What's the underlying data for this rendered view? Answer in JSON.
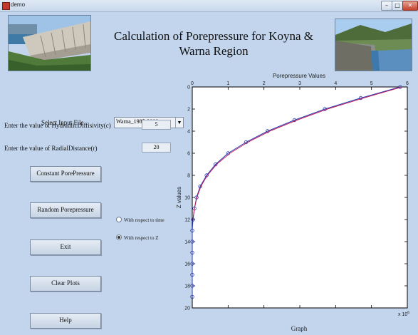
{
  "window": {
    "title": "demo",
    "min": "–",
    "max": "□",
    "close": "✕"
  },
  "header": {
    "title_line1": "Calculation of Porepressure for Koyna &",
    "title_line2": "Warna Region"
  },
  "form": {
    "select_label": "Select Input File",
    "file_value": "Warna_1985-2008.txt",
    "diff_label": "Enter the value of HydraulicDiffisivity(c)",
    "diff_value": "5",
    "rad_label": "Enter the value of RadialDistance(r)",
    "rad_value": "20"
  },
  "buttons": {
    "constant": "Constant PorePressure",
    "random": "Random Porepressure",
    "exit": "Exit",
    "clear": "Clear Plots",
    "help": "Help"
  },
  "radios": {
    "time": "With respect to time",
    "z": "With respect to Z",
    "selected": "z"
  },
  "chart_data": {
    "type": "line",
    "title": "Porepressure Values",
    "xlabel": "Graph",
    "ylabel": "Z values",
    "x_exponent_label": "x 10",
    "x_exponent": "6",
    "xlim": [
      0,
      6
    ],
    "ylim": [
      20,
      0
    ],
    "xticks": [
      "0",
      "1",
      "2",
      "3",
      "4",
      "5",
      "6"
    ],
    "yticks": [
      "0",
      "2",
      "4",
      "6",
      "8",
      "10",
      "12",
      "14",
      "16",
      "18",
      "20"
    ],
    "series": [
      {
        "color": "#2a3db0",
        "marker": "circle",
        "points": [
          [
            5.8,
            0
          ],
          [
            4.7,
            1
          ],
          [
            3.7,
            2
          ],
          [
            2.85,
            3
          ],
          [
            2.1,
            4
          ],
          [
            1.5,
            5
          ],
          [
            1.0,
            6
          ],
          [
            0.65,
            7
          ],
          [
            0.4,
            8
          ],
          [
            0.22,
            9
          ],
          [
            0.12,
            10
          ],
          [
            0.06,
            11
          ],
          [
            0.02,
            12
          ],
          [
            0.0,
            13
          ],
          [
            0.0,
            14
          ],
          [
            0.0,
            15
          ],
          [
            0.0,
            16
          ],
          [
            0.0,
            17
          ],
          [
            0.0,
            18
          ],
          [
            0.0,
            19
          ]
        ]
      },
      {
        "color": "#c2185b",
        "marker": "none",
        "points": [
          [
            5.85,
            0
          ],
          [
            4.78,
            1
          ],
          [
            3.77,
            2
          ],
          [
            2.92,
            3
          ],
          [
            2.16,
            4
          ],
          [
            1.55,
            5
          ],
          [
            1.05,
            6
          ],
          [
            0.68,
            7
          ],
          [
            0.42,
            8
          ],
          [
            0.24,
            9
          ],
          [
            0.13,
            10
          ],
          [
            0.06,
            11
          ],
          [
            0.02,
            12
          ]
        ]
      }
    ],
    "colors": {
      "frame": "#000000",
      "background": "#ffffff"
    }
  }
}
